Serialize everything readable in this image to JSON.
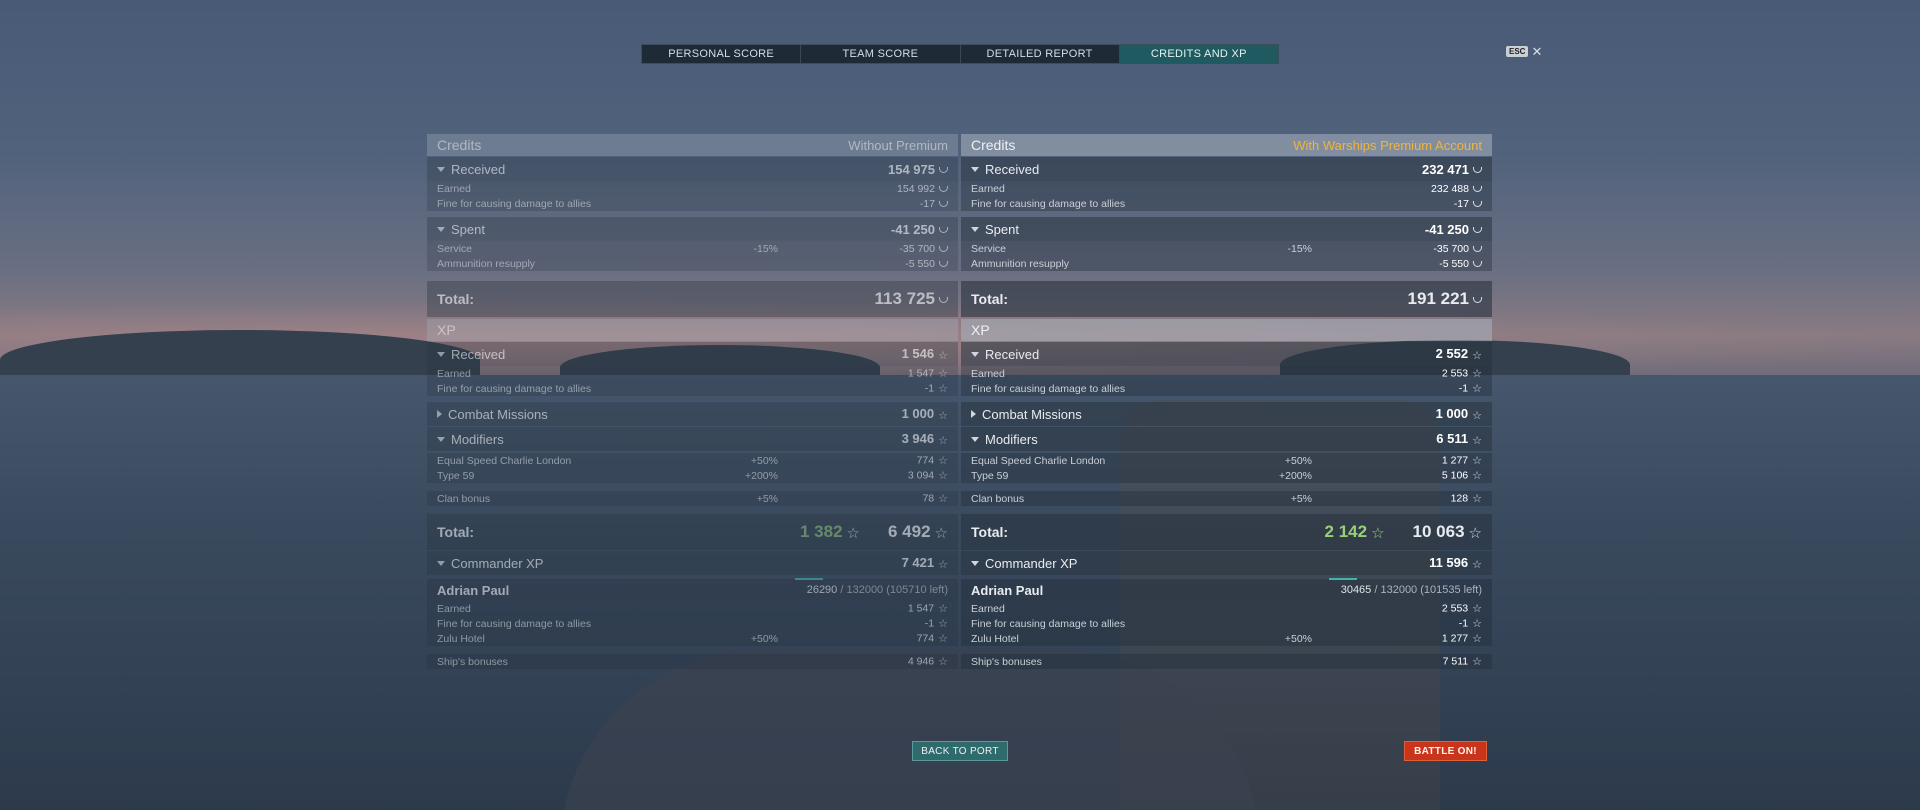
{
  "tabs": [
    "PERSONAL SCORE",
    "TEAM SCORE",
    "DETAILED REPORT",
    "CREDITS AND XP"
  ],
  "active_tab": "CREDITS AND XP",
  "esc_label": "ESC",
  "left": {
    "credits_title": "Credits",
    "credits_sub": "Without Premium",
    "received_label": "Received",
    "received_value": "154 975",
    "earned_label": "Earned",
    "earned_value": "154 992",
    "fine_label": "Fine for causing damage to allies",
    "fine_value": "-17",
    "spent_label": "Spent",
    "spent_value": "-41 250",
    "service_label": "Service",
    "service_pct": "-15%",
    "service_value": "-35 700",
    "ammo_label": "Ammunition resupply",
    "ammo_value": "-5 550",
    "total_label": "Total:",
    "total_credits": "113 725",
    "xp_title": "XP",
    "xp_received_label": "Received",
    "xp_received_value": "1 546",
    "xp_earned_label": "Earned",
    "xp_earned_value": "1 547",
    "xp_fine_label": "Fine for causing damage to allies",
    "xp_fine_value": "-1",
    "missions_label": "Combat Missions",
    "missions_value": "1 000",
    "modifiers_label": "Modifiers",
    "modifiers_value": "3 946",
    "mod1_label": "Equal Speed Charlie London",
    "mod1_pct": "+50%",
    "mod1_value": "774",
    "mod2_label": "Type 59",
    "mod2_pct": "+200%",
    "mod2_value": "3 094",
    "clan_label": "Clan bonus",
    "clan_pct": "+5%",
    "clan_value": "78",
    "xp_total_label": "Total:",
    "xp_total_green": "1 382",
    "xp_total": "6 492",
    "cmd_label": "Commander XP",
    "cmd_value": "7 421",
    "captain_name": "Adrian Paul",
    "captain_xp": "26290",
    "captain_rest": "/ 132000 (105710 left)",
    "c_earned_label": "Earned",
    "c_earned_value": "1 547",
    "c_fine_label": "Fine for causing damage to allies",
    "c_fine_value": "-1",
    "zulu_label": "Zulu Hotel",
    "zulu_pct": "+50%",
    "zulu_value": "774",
    "ship_label": "Ship's bonuses",
    "ship_value": "4 946"
  },
  "right": {
    "credits_title": "Credits",
    "credits_sub": "With Warships Premium Account",
    "received_label": "Received",
    "received_value": "232 471",
    "earned_label": "Earned",
    "earned_value": "232 488",
    "fine_label": "Fine for causing damage to allies",
    "fine_value": "-17",
    "spent_label": "Spent",
    "spent_value": "-41 250",
    "service_label": "Service",
    "service_pct": "-15%",
    "service_value": "-35 700",
    "ammo_label": "Ammunition resupply",
    "ammo_value": "-5 550",
    "total_label": "Total:",
    "total_credits": "191 221",
    "xp_title": "XP",
    "xp_received_label": "Received",
    "xp_received_value": "2 552",
    "xp_earned_label": "Earned",
    "xp_earned_value": "2 553",
    "xp_fine_label": "Fine for causing damage to allies",
    "xp_fine_value": "-1",
    "missions_label": "Combat Missions",
    "missions_value": "1 000",
    "modifiers_label": "Modifiers",
    "modifiers_value": "6 511",
    "mod1_label": "Equal Speed Charlie London",
    "mod1_pct": "+50%",
    "mod1_value": "1 277",
    "mod2_label": "Type 59",
    "mod2_pct": "+200%",
    "mod2_value": "5 106",
    "clan_label": "Clan bonus",
    "clan_pct": "+5%",
    "clan_value": "128",
    "xp_total_label": "Total:",
    "xp_total_green": "2 142",
    "xp_total": "10 063",
    "cmd_label": "Commander XP",
    "cmd_value": "11 596",
    "captain_name": "Adrian Paul",
    "captain_xp": "30465",
    "captain_rest": "/ 132000 (101535 left)",
    "c_earned_label": "Earned",
    "c_earned_value": "2 553",
    "c_fine_label": "Fine for causing damage to allies",
    "c_fine_value": "-1",
    "zulu_label": "Zulu Hotel",
    "zulu_pct": "+50%",
    "zulu_value": "1 277",
    "ship_label": "Ship's bonuses",
    "ship_value": "7 511"
  },
  "buttons": {
    "back_to_port": "BACK TO PORT",
    "battle_on": "BATTLE ON!"
  }
}
